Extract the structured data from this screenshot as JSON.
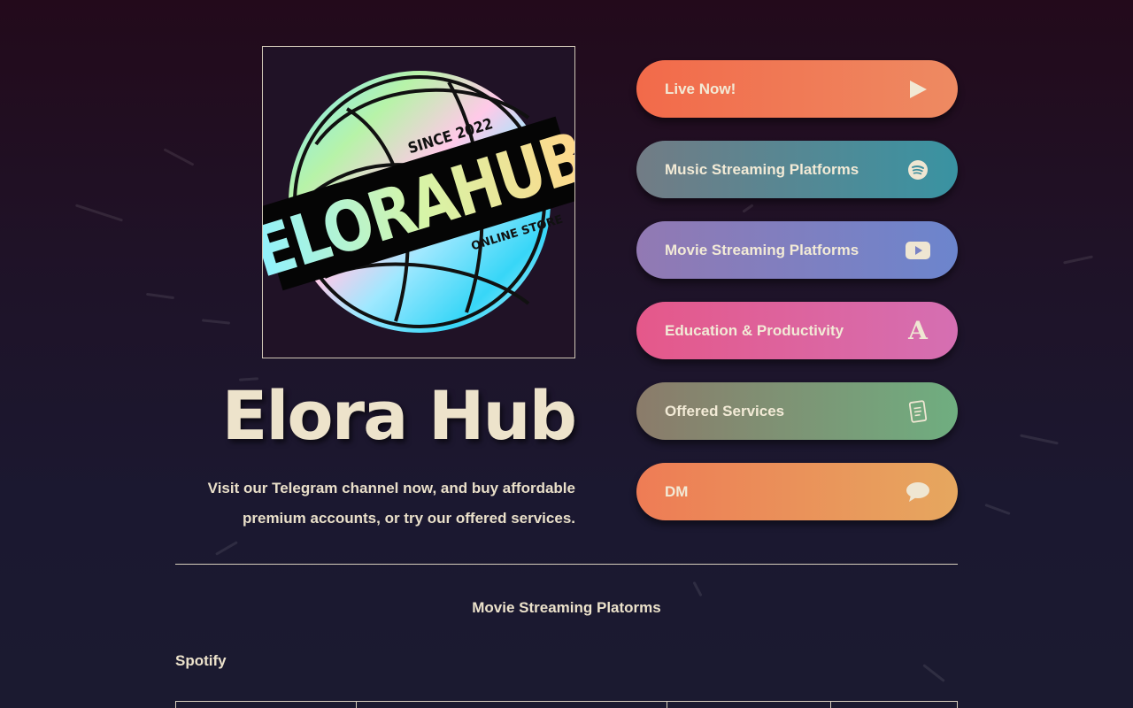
{
  "brand": {
    "logo_text": "ELORAHUB",
    "logo_since": "SINCE 2022",
    "logo_tagline": "ONLINE STORE",
    "title": "Elora Hub",
    "description": "Visit our Telegram channel now, and buy affordable premium accounts, or try our offered services."
  },
  "links": [
    {
      "label": "Live Now!",
      "icon": "play-icon"
    },
    {
      "label": "Music Streaming Platforms",
      "icon": "spotify-icon"
    },
    {
      "label": "Movie Streaming Platforms",
      "icon": "youtube-icon"
    },
    {
      "label": "Education & Productivity",
      "icon": "letter-a-icon"
    },
    {
      "label": "Offered Services",
      "icon": "document-icon"
    },
    {
      "label": "DM",
      "icon": "chat-bubble-icon"
    }
  ],
  "section": {
    "title": "Movie Streaming Platorms",
    "subtitle": "Spotify"
  },
  "colors": {
    "background": "#1f1227",
    "text": "#efe6cf",
    "live": "#f26a4a",
    "music": "#3993a2",
    "movie": "#6c85cd",
    "education": "#e5588a",
    "offered": "#6fae80",
    "dm": "#e6a75f"
  }
}
